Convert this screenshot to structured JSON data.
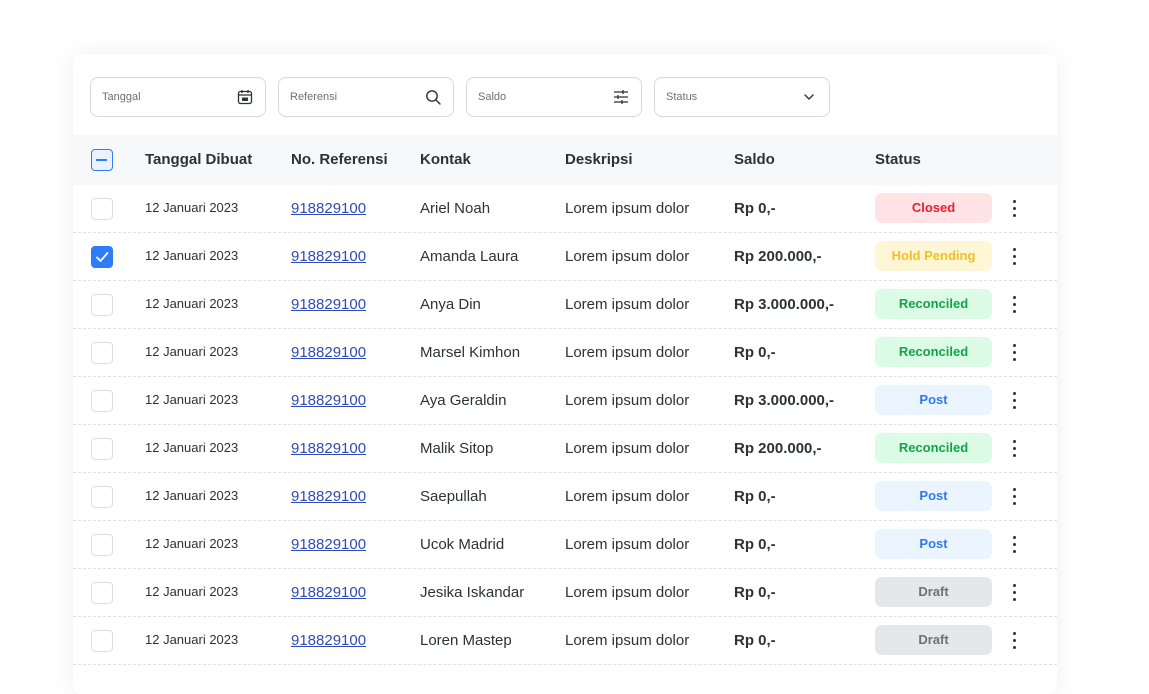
{
  "filters": [
    {
      "label": "Tanggal",
      "icon": "calendar-icon"
    },
    {
      "label": "Referensi",
      "icon": "search-icon"
    },
    {
      "label": "Saldo",
      "icon": "sliders-icon"
    },
    {
      "label": "Status",
      "icon": "chevron-down-icon"
    }
  ],
  "table": {
    "headers": {
      "date": "Tanggal Dibuat",
      "ref": "No. Referensi",
      "contact": "Kontak",
      "description": "Deskripsi",
      "amount": "Saldo",
      "status": "Status"
    },
    "select_all_state": "indeterminate",
    "rows": [
      {
        "checked": false,
        "date": "12 Januari 2023",
        "ref": "918829100",
        "contact": "Ariel Noah",
        "description": "Lorem ipsum dolor",
        "amount": "Rp 0,-",
        "status": "Closed"
      },
      {
        "checked": true,
        "date": "12 Januari 2023",
        "ref": "918829100",
        "contact": "Amanda Laura",
        "description": "Lorem ipsum dolor",
        "amount": "Rp 200.000,-",
        "status": "Hold Pending"
      },
      {
        "checked": false,
        "date": "12 Januari 2023",
        "ref": "918829100",
        "contact": "Anya Din",
        "description": "Lorem ipsum dolor",
        "amount": "Rp 3.000.000,-",
        "status": "Reconciled"
      },
      {
        "checked": false,
        "date": "12 Januari 2023",
        "ref": "918829100",
        "contact": "Marsel Kimhon",
        "description": "Lorem ipsum dolor",
        "amount": "Rp 0,-",
        "status": "Reconciled"
      },
      {
        "checked": false,
        "date": "12 Januari 2023",
        "ref": "918829100",
        "contact": "Aya Geraldin",
        "description": "Lorem ipsum dolor",
        "amount": "Rp 3.000.000,-",
        "status": "Post"
      },
      {
        "checked": false,
        "date": "12 Januari 2023",
        "ref": "918829100",
        "contact": "Malik Sitop",
        "description": "Lorem ipsum dolor",
        "amount": "Rp 200.000,-",
        "status": "Reconciled"
      },
      {
        "checked": false,
        "date": "12 Januari 2023",
        "ref": "918829100",
        "contact": "Saepullah",
        "description": "Lorem ipsum dolor",
        "amount": "Rp 0,-",
        "status": "Post"
      },
      {
        "checked": false,
        "date": "12 Januari 2023",
        "ref": "918829100",
        "contact": "Ucok Madrid",
        "description": "Lorem ipsum dolor",
        "amount": "Rp 0,-",
        "status": "Post"
      },
      {
        "checked": false,
        "date": "12 Januari 2023",
        "ref": "918829100",
        "contact": "Jesika Iskandar",
        "description": "Lorem ipsum dolor",
        "amount": "Rp 0,-",
        "status": "Draft"
      },
      {
        "checked": false,
        "date": "12 Januari 2023",
        "ref": "918829100",
        "contact": "Loren Mastep",
        "description": "Lorem ipsum dolor",
        "amount": "Rp 0,-",
        "status": "Draft"
      }
    ]
  },
  "status_styles": {
    "Closed": {
      "bg": "#ffe3e5",
      "fg": "#ee1d2e"
    },
    "Hold Pending": {
      "bg": "#fff6d6",
      "fg": "#f7bf1d"
    },
    "Reconciled": {
      "bg": "#dcfbe6",
      "fg": "#14a349"
    },
    "Post": {
      "bg": "#ebf5ff",
      "fg": "#2d7bf0"
    },
    "Draft": {
      "bg": "#e6e7e9",
      "fg": "#6c7078"
    }
  },
  "colors": {
    "accent": "#2e7cf6",
    "link": "#2f4bb8"
  }
}
